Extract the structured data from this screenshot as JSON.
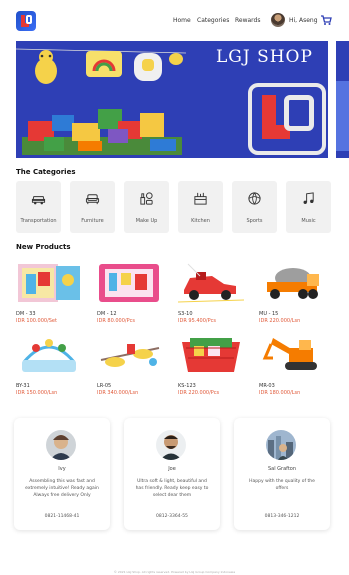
{
  "header": {
    "nav": [
      "Home",
      "Categories",
      "Rewards"
    ],
    "user_name": "Hi, Aseng"
  },
  "banner": {
    "title": "LGJ SHOP"
  },
  "categories": {
    "title": "The Categories",
    "items": [
      {
        "label": "Transportation",
        "icon": "car-icon"
      },
      {
        "label": "Furniture",
        "icon": "sofa-icon"
      },
      {
        "label": "Make Up",
        "icon": "makeup-icon"
      },
      {
        "label": "Kitchen",
        "icon": "kitchen-icon"
      },
      {
        "label": "Sports",
        "icon": "ball-icon"
      },
      {
        "label": "Music",
        "icon": "music-icon"
      }
    ]
  },
  "products": {
    "title": "New Products",
    "items": [
      {
        "name": "DM - 33",
        "price": "IDR 100.000/Set"
      },
      {
        "name": "DM - 12",
        "price": "IDR 80.000/Pcs"
      },
      {
        "name": "S3-10",
        "price": "IDR 95.400/Pcs"
      },
      {
        "name": "MU - 15",
        "price": "IDR 220.000/Lsn"
      },
      {
        "name": "BY-31",
        "price": "IDR 150.000/Lsn"
      },
      {
        "name": "LR-05",
        "price": "IDR 340.000/Lsn"
      },
      {
        "name": "KS-123",
        "price": "IDR 220.000/Pcs"
      },
      {
        "name": "MR-03",
        "price": "IDR 180.000/Lsn"
      }
    ]
  },
  "testimonials": [
    {
      "name": "Ivy",
      "text": "Assembling this was fast and extremely intuitive! Ready again Always free delivery Only",
      "phone": "0821-11468-41"
    },
    {
      "name": "Joe",
      "text": "Ultra soft & light, beautiful and has friendly. Ready keep easy to select dear them",
      "phone": "0812-3364-55"
    },
    {
      "name": "Sal Grafton",
      "text": "Happy with the quality of the offers",
      "phone": "0813-346-1212"
    }
  ],
  "footer": {
    "text": "© 2021 LGJ Shop. All rights reserved. Powered by LGJ Group Company Indonesia"
  },
  "colors": {
    "banner_bg": "#2e3fb5",
    "accent_red": "#e53935",
    "price": "#e05a3a"
  }
}
